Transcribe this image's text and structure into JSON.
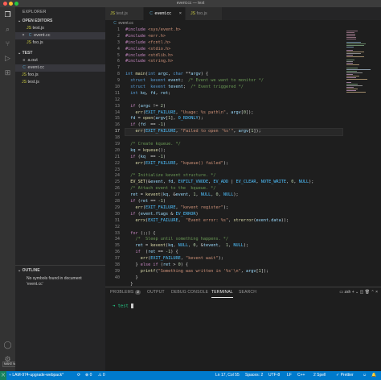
{
  "window": {
    "title": "event.cc — test"
  },
  "activity": [
    "files-icon",
    "search-icon",
    "source-control-icon",
    "run-debug-icon",
    "extensions-icon",
    "account-icon",
    "settings-gear-icon"
  ],
  "sidebar": {
    "title": "EXPLORER",
    "open_editors_label": "OPEN EDITORS",
    "open_editors": [
      {
        "name": "test.js",
        "icon": "js"
      },
      {
        "name": "event.cc",
        "icon": "cc"
      },
      {
        "name": "foo.js",
        "icon": "js"
      }
    ],
    "folder_label": "TEST",
    "files": [
      {
        "name": "a.out",
        "icon": "bin"
      },
      {
        "name": "event.cc",
        "icon": "cc"
      },
      {
        "name": "foo.js",
        "icon": "js"
      },
      {
        "name": "test.js",
        "icon": "js"
      }
    ],
    "outline_label": "OUTLINE",
    "outline_message": "No symbols found in document 'event.cc'",
    "hover_tooltip": "MAKE WITH VIEWS"
  },
  "tabs": [
    {
      "label": "test.js",
      "icon": "js"
    },
    {
      "label": "event.cc",
      "icon": "cc"
    },
    {
      "label": "foo.js",
      "icon": "js"
    }
  ],
  "breadcrumb": "event.cc",
  "editor": {
    "current_line": 17,
    "line_numbers": [
      "1",
      "2",
      "3",
      "4",
      "5",
      "6",
      "7",
      "8",
      "9",
      "10",
      "11",
      "12",
      "13",
      "14",
      "15",
      "16",
      "17",
      "18",
      "19",
      "20",
      "21",
      "22",
      "23",
      "24",
      "25",
      "26",
      "27",
      "28",
      "29",
      "30",
      "31",
      "32",
      "33",
      "34",
      "35",
      "36",
      "37",
      "38",
      "39",
      "40"
    ]
  },
  "panel": {
    "tabs": [
      "PROBLEMS",
      "OUTPUT",
      "DEBUG CONSOLE",
      "TERMINAL",
      "SEARCH"
    ],
    "problems_count": "2",
    "terminal_shell": "zsh",
    "terminal_prompt": "➜  test"
  },
  "statusbar": {
    "branch": "LAM-974-upgrade-webpack*",
    "errors": "⊗ 0",
    "warnings": "⚠ 0",
    "position": "Ln 17, Col 55",
    "spaces": "Spaces: 2",
    "encoding": "UTF-8",
    "eol": "LF",
    "language": "C++",
    "spell": "2 Spell",
    "prettier": "✓ Prettier"
  }
}
